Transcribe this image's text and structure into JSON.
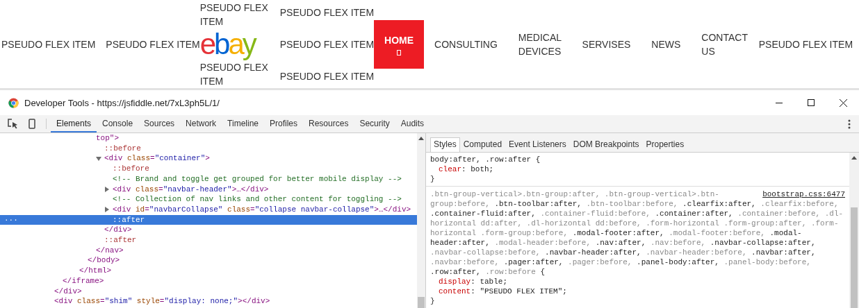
{
  "nav": {
    "columns": [
      {
        "kind": "item",
        "label": "PSEUDO FLEX ITEM"
      },
      {
        "kind": "item",
        "label": "PSEUDO FLEX ITEM"
      },
      {
        "kind": "brand",
        "items": [
          {
            "kind": "text",
            "label": "PSEUDO FLEX ITEM"
          },
          {
            "kind": "logo",
            "label": "ebay"
          },
          {
            "kind": "text",
            "label": "PSEUDO FLEX ITEM"
          }
        ]
      },
      {
        "kind": "stack",
        "items": [
          {
            "kind": "text",
            "label": "PSEUDO FLEX ITEM"
          },
          {
            "kind": "text",
            "label": "PSEUDO FLEX ITEM"
          },
          {
            "kind": "text",
            "label": "PSEUDO FLEX ITEM"
          }
        ]
      },
      {
        "kind": "link",
        "label": "HOME",
        "selected": true,
        "icon": true
      },
      {
        "kind": "link",
        "label": "CONSULTING",
        "selected": false,
        "icon": false
      },
      {
        "kind": "link",
        "label": "MEDICAL DEVICES",
        "selected": false,
        "icon": false
      },
      {
        "kind": "link",
        "label": "SERVISES",
        "selected": false,
        "icon": false
      },
      {
        "kind": "link",
        "label": "NEWS",
        "selected": false,
        "icon": false
      },
      {
        "kind": "link",
        "label": "CONTACT US",
        "selected": false,
        "icon": false
      },
      {
        "kind": "overlap",
        "items": [
          {
            "kind": "text",
            "label": "PSEUDO FLEX ITEM"
          }
        ]
      }
    ]
  },
  "devtools": {
    "title": "Developer Tools - https://jsfiddle.net/7xL3ph5L/1/",
    "tabs": [
      {
        "label": "Elements",
        "selected": true
      },
      {
        "label": "Console",
        "selected": false
      },
      {
        "label": "Sources",
        "selected": false
      },
      {
        "label": "Network",
        "selected": false
      },
      {
        "label": "Timeline",
        "selected": false
      },
      {
        "label": "Profiles",
        "selected": false
      },
      {
        "label": "Resources",
        "selected": false
      },
      {
        "label": "Security",
        "selected": false
      },
      {
        "label": "Audits",
        "selected": false
      }
    ],
    "dom_tree": [
      {
        "kind": "tag",
        "close": "</div>",
        "selected": false,
        "children": [
          {
            "kind": "tag",
            "close": "</iframe>",
            "selected": false,
            "children": [
              {
                "kind": "document",
                "children": [
                  {
                    "kind": "tag",
                    "close": "</html>",
                    "selected": false,
                    "children": [
                      {
                        "kind": "tag",
                        "close": "</body>",
                        "selected": false,
                        "children": [
                          {
                            "kind": "tag",
                            "open": "top\">",
                            "close": "</nav>",
                            "selected": false,
                            "children": [
                              {
                                "kind": "pseudo",
                                "open": "::before",
                                "selected": false
                              },
                              {
                                "kind": "tag",
                                "open": "<div class=\"container\">",
                                "expanded": true,
                                "close": "</div>",
                                "selected": false,
                                "children": [
                                  {
                                    "kind": "pseudo",
                                    "open": "::before",
                                    "selected": false
                                  },
                                  {
                                    "kind": "comment",
                                    "open": "<!-- Brand and toggle get grouped for better mobile display -->",
                                    "selected": false
                                  },
                                  {
                                    "kind": "tag",
                                    "open": "<div class=\"navbar-header\">…</div>",
                                    "expanded": false,
                                    "selected": false
                                  },
                                  {
                                    "kind": "comment",
                                    "open": "<!-- Collection of nav links and other content for toggling -->",
                                    "selected": false
                                  },
                                  {
                                    "kind": "tag",
                                    "open": "<div id=\"navbarCollapse\" class=\"collapse navbar-collapse\">…</div>",
                                    "expanded": false,
                                    "selected": false
                                  },
                                  {
                                    "kind": "pseudo",
                                    "open": "::after",
                                    "selected": true,
                                    "gutter": "···"
                                  }
                                ]
                              },
                              {
                                "kind": "pseudo",
                                "open": "::after",
                                "selected": false
                              }
                            ]
                          }
                        ]
                      }
                    ]
                  }
                ]
              }
            ]
          }
        ]
      },
      {
        "kind": "tag",
        "open": "<div class=\"shim\" style=\"display: none;\"></div>",
        "selected": false
      }
    ],
    "style_tabs": [
      {
        "label": "Styles",
        "selected": true
      },
      {
        "label": "Computed",
        "selected": false
      },
      {
        "label": "Event Listeners",
        "selected": false
      },
      {
        "label": "DOM Breakpoints",
        "selected": false
      },
      {
        "label": "Properties",
        "selected": false
      }
    ],
    "rules": [
      {
        "selector_lines": [
          [
            {
              "text": "body:after, .row:after {",
              "matched": true
            }
          ]
        ],
        "declarations": [
          "clear: both;"
        ],
        "close": "}"
      },
      {
        "source": "bootstrap.css:6477",
        "selector_lines": [
          [
            {
              "text": ".btn-group-vertical>.btn-group:after, .btn-group-vertical>.btn-",
              "matched": false
            }
          ],
          [
            {
              "text": "group:before, ",
              "matched": false
            },
            {
              "text": ".btn-toolbar:after, ",
              "matched": true
            },
            {
              "text": ".btn-toolbar:before, ",
              "matched": false
            },
            {
              "text": ".clearfix:after, ",
              "matched": true
            },
            {
              "text": ".clearfix:before,",
              "matched": false
            }
          ],
          [
            {
              "text": ".container-fluid:after, ",
              "matched": true
            },
            {
              "text": ".container-fluid:before, ",
              "matched": false
            },
            {
              "text": ".container:after, ",
              "matched": true
            },
            {
              "text": ".container:before, .dl-",
              "matched": false
            }
          ],
          [
            {
              "text": "horizontal dd:after, .dl-horizontal dd:before, .form-horizontal .form-group:after, .form-",
              "matched": false
            }
          ],
          [
            {
              "text": "horizontal .form-group:before, ",
              "matched": false
            },
            {
              "text": ".modal-footer:after, ",
              "matched": true
            },
            {
              "text": ".modal-footer:before, ",
              "matched": false
            },
            {
              "text": ".modal-",
              "matched": true
            }
          ],
          [
            {
              "text": "header:after, ",
              "matched": true
            },
            {
              "text": ".modal-header:before, ",
              "matched": false
            },
            {
              "text": ".nav:after, ",
              "matched": true
            },
            {
              "text": ".nav:before, ",
              "matched": false
            },
            {
              "text": ".navbar-collapse:after,",
              "matched": true
            }
          ],
          [
            {
              "text": ".navbar-collapse:before, ",
              "matched": false
            },
            {
              "text": ".navbar-header:after, ",
              "matched": true
            },
            {
              "text": ".navbar-header:before, ",
              "matched": false
            },
            {
              "text": ".navbar:after,",
              "matched": true
            }
          ],
          [
            {
              "text": ".navbar:before, ",
              "matched": false
            },
            {
              "text": ".pager:after, ",
              "matched": true
            },
            {
              "text": ".pager:before, ",
              "matched": false
            },
            {
              "text": ".panel-body:after, ",
              "matched": true
            },
            {
              "text": ".panel-body:before,",
              "matched": false
            }
          ],
          [
            {
              "text": ".row:after, ",
              "matched": true
            },
            {
              "text": ".row:before ",
              "matched": false
            },
            {
              "text": "{",
              "matched": true
            }
          ]
        ],
        "declarations": [
          "display: table;",
          "content: \"PSEUDO FLEX ITEM\";"
        ],
        "close": "}"
      }
    ]
  }
}
